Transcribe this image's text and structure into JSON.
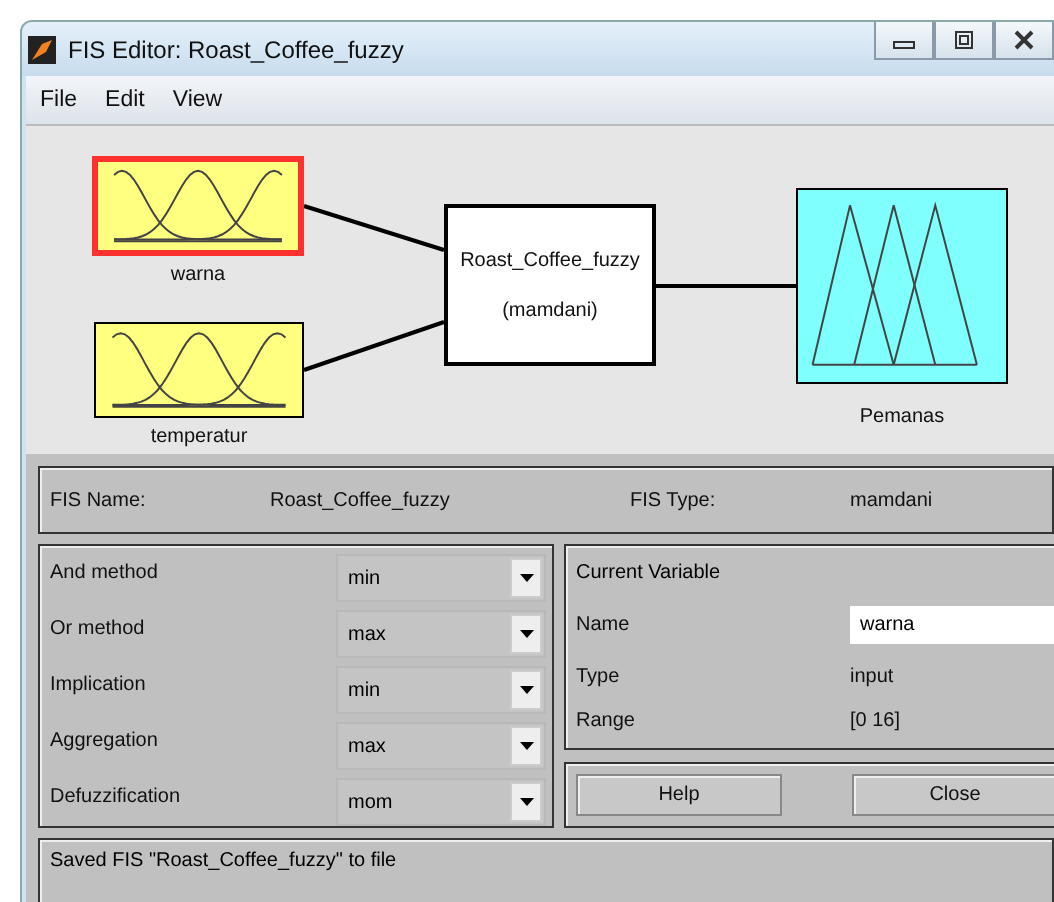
{
  "window": {
    "title": "FIS Editor: Roast_Coffee_fuzzy"
  },
  "menu": [
    "File",
    "Edit",
    "View"
  ],
  "diagram": {
    "inputs": [
      {
        "name": "warna",
        "selected": true,
        "kind": "gauss"
      },
      {
        "name": "temperatur",
        "selected": false,
        "kind": "gauss"
      }
    ],
    "system": {
      "name": "Roast_Coffee_fuzzy",
      "type": "(mamdani)"
    },
    "output": {
      "name": "Pemanas",
      "kind": "tri"
    }
  },
  "fis_info": {
    "name_label": "FIS Name:",
    "name": "Roast_Coffee_fuzzy",
    "type_label": "FIS Type:",
    "type": "mamdani"
  },
  "methods": [
    {
      "label": "And method",
      "value": "min"
    },
    {
      "label": "Or method",
      "value": "max"
    },
    {
      "label": "Implication",
      "value": "min"
    },
    {
      "label": "Aggregation",
      "value": "max"
    },
    {
      "label": "Defuzzification",
      "value": "mom"
    }
  ],
  "current_variable": {
    "title": "Current Variable",
    "name_label": "Name",
    "name": "warna",
    "type_label": "Type",
    "type": "input",
    "range_label": "Range",
    "range": "[0 16]"
  },
  "buttons": [
    "Help",
    "Close"
  ],
  "status_bar": "Saved FIS \"Roast_Coffee_fuzzy\" to file"
}
